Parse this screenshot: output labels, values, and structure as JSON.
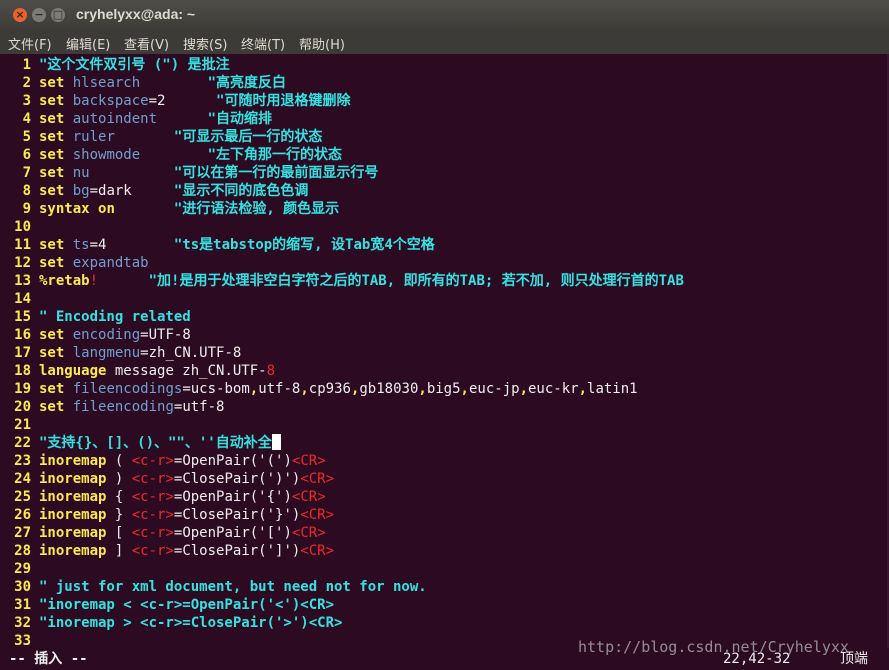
{
  "window": {
    "title": "cryhelyxx@ada: ~",
    "close_symbol": "×",
    "minimize_symbol": "−",
    "maximize_symbol": "□"
  },
  "menubar": {
    "items": [
      "文件(F)",
      "编辑(E)",
      "查看(V)",
      "搜索(S)",
      "终端(T)",
      "帮助(H)"
    ]
  },
  "colors": {
    "background": "#2c0b22",
    "line_number": "#fce94f",
    "keyword": "#fce94f",
    "option": "#729fcf",
    "comment": "#34e2e2",
    "special_key": "#ef2929",
    "text": "#eeeeee"
  },
  "lines": [
    {
      "n": "1",
      "parts": [
        {
          "t": "\"这个文件双引号 (\") 是批注",
          "c": "cmt"
        }
      ]
    },
    {
      "n": "2",
      "parts": [
        {
          "t": "set",
          "c": "kw"
        },
        {
          "t": " "
        },
        {
          "t": "hlsearch",
          "c": "opt"
        },
        {
          "t": "        "
        },
        {
          "t": "\"高亮度反白",
          "c": "cmt"
        }
      ]
    },
    {
      "n": "3",
      "parts": [
        {
          "t": "set",
          "c": "kw"
        },
        {
          "t": " "
        },
        {
          "t": "backspace",
          "c": "opt"
        },
        {
          "t": "=2      "
        },
        {
          "t": "\"可随时用退格键删除",
          "c": "cmt"
        }
      ]
    },
    {
      "n": "4",
      "parts": [
        {
          "t": "set",
          "c": "kw"
        },
        {
          "t": " "
        },
        {
          "t": "autoindent",
          "c": "opt"
        },
        {
          "t": "      "
        },
        {
          "t": "\"自动缩排",
          "c": "cmt"
        }
      ]
    },
    {
      "n": "5",
      "parts": [
        {
          "t": "set",
          "c": "kw"
        },
        {
          "t": " "
        },
        {
          "t": "ruler",
          "c": "opt"
        },
        {
          "t": "       "
        },
        {
          "t": "\"可显示最后一行的状态",
          "c": "cmt"
        }
      ]
    },
    {
      "n": "6",
      "parts": [
        {
          "t": "set",
          "c": "kw"
        },
        {
          "t": " "
        },
        {
          "t": "showmode",
          "c": "opt"
        },
        {
          "t": "        "
        },
        {
          "t": "\"左下角那一行的状态",
          "c": "cmt"
        }
      ]
    },
    {
      "n": "7",
      "parts": [
        {
          "t": "set",
          "c": "kw"
        },
        {
          "t": " "
        },
        {
          "t": "nu",
          "c": "opt"
        },
        {
          "t": "          "
        },
        {
          "t": "\"可以在第一行的最前面显示行号",
          "c": "cmt"
        }
      ]
    },
    {
      "n": "8",
      "parts": [
        {
          "t": "set",
          "c": "kw"
        },
        {
          "t": " "
        },
        {
          "t": "bg",
          "c": "opt"
        },
        {
          "t": "=dark     "
        },
        {
          "t": "\"显示不同的底色色调",
          "c": "cmt"
        }
      ]
    },
    {
      "n": "9",
      "parts": [
        {
          "t": "syntax",
          "c": "kw"
        },
        {
          "t": " "
        },
        {
          "t": "on",
          "c": "kw"
        },
        {
          "t": "       "
        },
        {
          "t": "\"进行语法检验, 颜色显示",
          "c": "cmt"
        }
      ]
    },
    {
      "n": "10",
      "parts": []
    },
    {
      "n": "11",
      "parts": [
        {
          "t": "set",
          "c": "kw"
        },
        {
          "t": " "
        },
        {
          "t": "ts",
          "c": "opt"
        },
        {
          "t": "=4        "
        },
        {
          "t": "\"ts是tabstop的缩写, 设Tab宽4个空格",
          "c": "cmt"
        }
      ]
    },
    {
      "n": "12",
      "parts": [
        {
          "t": "set",
          "c": "kw"
        },
        {
          "t": " "
        },
        {
          "t": "expandtab",
          "c": "opt"
        }
      ]
    },
    {
      "n": "13",
      "parts": [
        {
          "t": "%retab",
          "c": "kw"
        },
        {
          "t": "!",
          "c": "sp"
        },
        {
          "t": "      "
        },
        {
          "t": "\"加!是用于处理非空白字符之后的TAB, 即所有的TAB; 若不加, 则只处理行首的TAB",
          "c": "cmt"
        }
      ]
    },
    {
      "n": "14",
      "parts": []
    },
    {
      "n": "15",
      "parts": [
        {
          "t": "\" Encoding related",
          "c": "cmt"
        }
      ]
    },
    {
      "n": "16",
      "parts": [
        {
          "t": "set",
          "c": "kw"
        },
        {
          "t": " "
        },
        {
          "t": "encoding",
          "c": "opt"
        },
        {
          "t": "=UTF-8"
        }
      ]
    },
    {
      "n": "17",
      "parts": [
        {
          "t": "set",
          "c": "kw"
        },
        {
          "t": " "
        },
        {
          "t": "langmenu",
          "c": "opt"
        },
        {
          "t": "=zh_CN.UTF-8"
        }
      ]
    },
    {
      "n": "18",
      "parts": [
        {
          "t": "language",
          "c": "kw"
        },
        {
          "t": " message zh_CN.UTF-"
        },
        {
          "t": "8",
          "c": "sp"
        }
      ]
    },
    {
      "n": "19",
      "parts": [
        {
          "t": "set",
          "c": "kw"
        },
        {
          "t": " "
        },
        {
          "t": "fileencodings",
          "c": "opt"
        },
        {
          "t": "=ucs-bom"
        },
        {
          "t": ",",
          "c": "kw"
        },
        {
          "t": "utf-8"
        },
        {
          "t": ",",
          "c": "kw"
        },
        {
          "t": "cp936"
        },
        {
          "t": ",",
          "c": "kw"
        },
        {
          "t": "gb18030"
        },
        {
          "t": ",",
          "c": "kw"
        },
        {
          "t": "big5"
        },
        {
          "t": ",",
          "c": "kw"
        },
        {
          "t": "euc-jp"
        },
        {
          "t": ",",
          "c": "kw"
        },
        {
          "t": "euc-kr"
        },
        {
          "t": ",",
          "c": "kw"
        },
        {
          "t": "latin1"
        }
      ]
    },
    {
      "n": "20",
      "parts": [
        {
          "t": "set",
          "c": "kw"
        },
        {
          "t": " "
        },
        {
          "t": "fileencoding",
          "c": "opt"
        },
        {
          "t": "=utf-8"
        }
      ]
    },
    {
      "n": "21",
      "parts": []
    },
    {
      "n": "22",
      "parts": [
        {
          "t": "\"支持{}、[]、()、\"\"、''自动补全",
          "c": "cmt"
        }
      ],
      "cursor": true
    },
    {
      "n": "23",
      "parts": [
        {
          "t": "inoremap",
          "c": "kw"
        },
        {
          "t": " ( "
        },
        {
          "t": "<c-r>",
          "c": "sp"
        },
        {
          "t": "=OpenPair('(')"
        },
        {
          "t": "<CR>",
          "c": "sp"
        }
      ]
    },
    {
      "n": "24",
      "parts": [
        {
          "t": "inoremap",
          "c": "kw"
        },
        {
          "t": " ) "
        },
        {
          "t": "<c-r>",
          "c": "sp"
        },
        {
          "t": "=ClosePair(')')"
        },
        {
          "t": "<CR>",
          "c": "sp"
        }
      ]
    },
    {
      "n": "25",
      "parts": [
        {
          "t": "inoremap",
          "c": "kw"
        },
        {
          "t": " { "
        },
        {
          "t": "<c-r>",
          "c": "sp"
        },
        {
          "t": "=OpenPair('{')"
        },
        {
          "t": "<CR>",
          "c": "sp"
        }
      ]
    },
    {
      "n": "26",
      "parts": [
        {
          "t": "inoremap",
          "c": "kw"
        },
        {
          "t": " } "
        },
        {
          "t": "<c-r>",
          "c": "sp"
        },
        {
          "t": "=ClosePair('}')"
        },
        {
          "t": "<CR>",
          "c": "sp"
        }
      ]
    },
    {
      "n": "27",
      "parts": [
        {
          "t": "inoremap",
          "c": "kw"
        },
        {
          "t": " [ "
        },
        {
          "t": "<c-r>",
          "c": "sp"
        },
        {
          "t": "=OpenPair('[')"
        },
        {
          "t": "<CR>",
          "c": "sp"
        }
      ]
    },
    {
      "n": "28",
      "parts": [
        {
          "t": "inoremap",
          "c": "kw"
        },
        {
          "t": " ] "
        },
        {
          "t": "<c-r>",
          "c": "sp"
        },
        {
          "t": "=ClosePair(']')"
        },
        {
          "t": "<CR>",
          "c": "sp"
        }
      ]
    },
    {
      "n": "29",
      "parts": []
    },
    {
      "n": "30",
      "parts": [
        {
          "t": "\" just for xml document, but need not for now.",
          "c": "cmt"
        }
      ]
    },
    {
      "n": "31",
      "parts": [
        {
          "t": "\"inoremap < <c-r>=OpenPair('<')<CR>",
          "c": "cmt"
        }
      ]
    },
    {
      "n": "32",
      "parts": [
        {
          "t": "\"inoremap > <c-r>=ClosePair('>')<CR>",
          "c": "cmt"
        }
      ]
    },
    {
      "n": "33",
      "parts": []
    }
  ],
  "statusbar": {
    "mode": "-- 插入 --",
    "position": "22,42-32",
    "scroll": "顶端"
  },
  "watermark_text": "http://blog.csdn.net/Cryhelyxx"
}
